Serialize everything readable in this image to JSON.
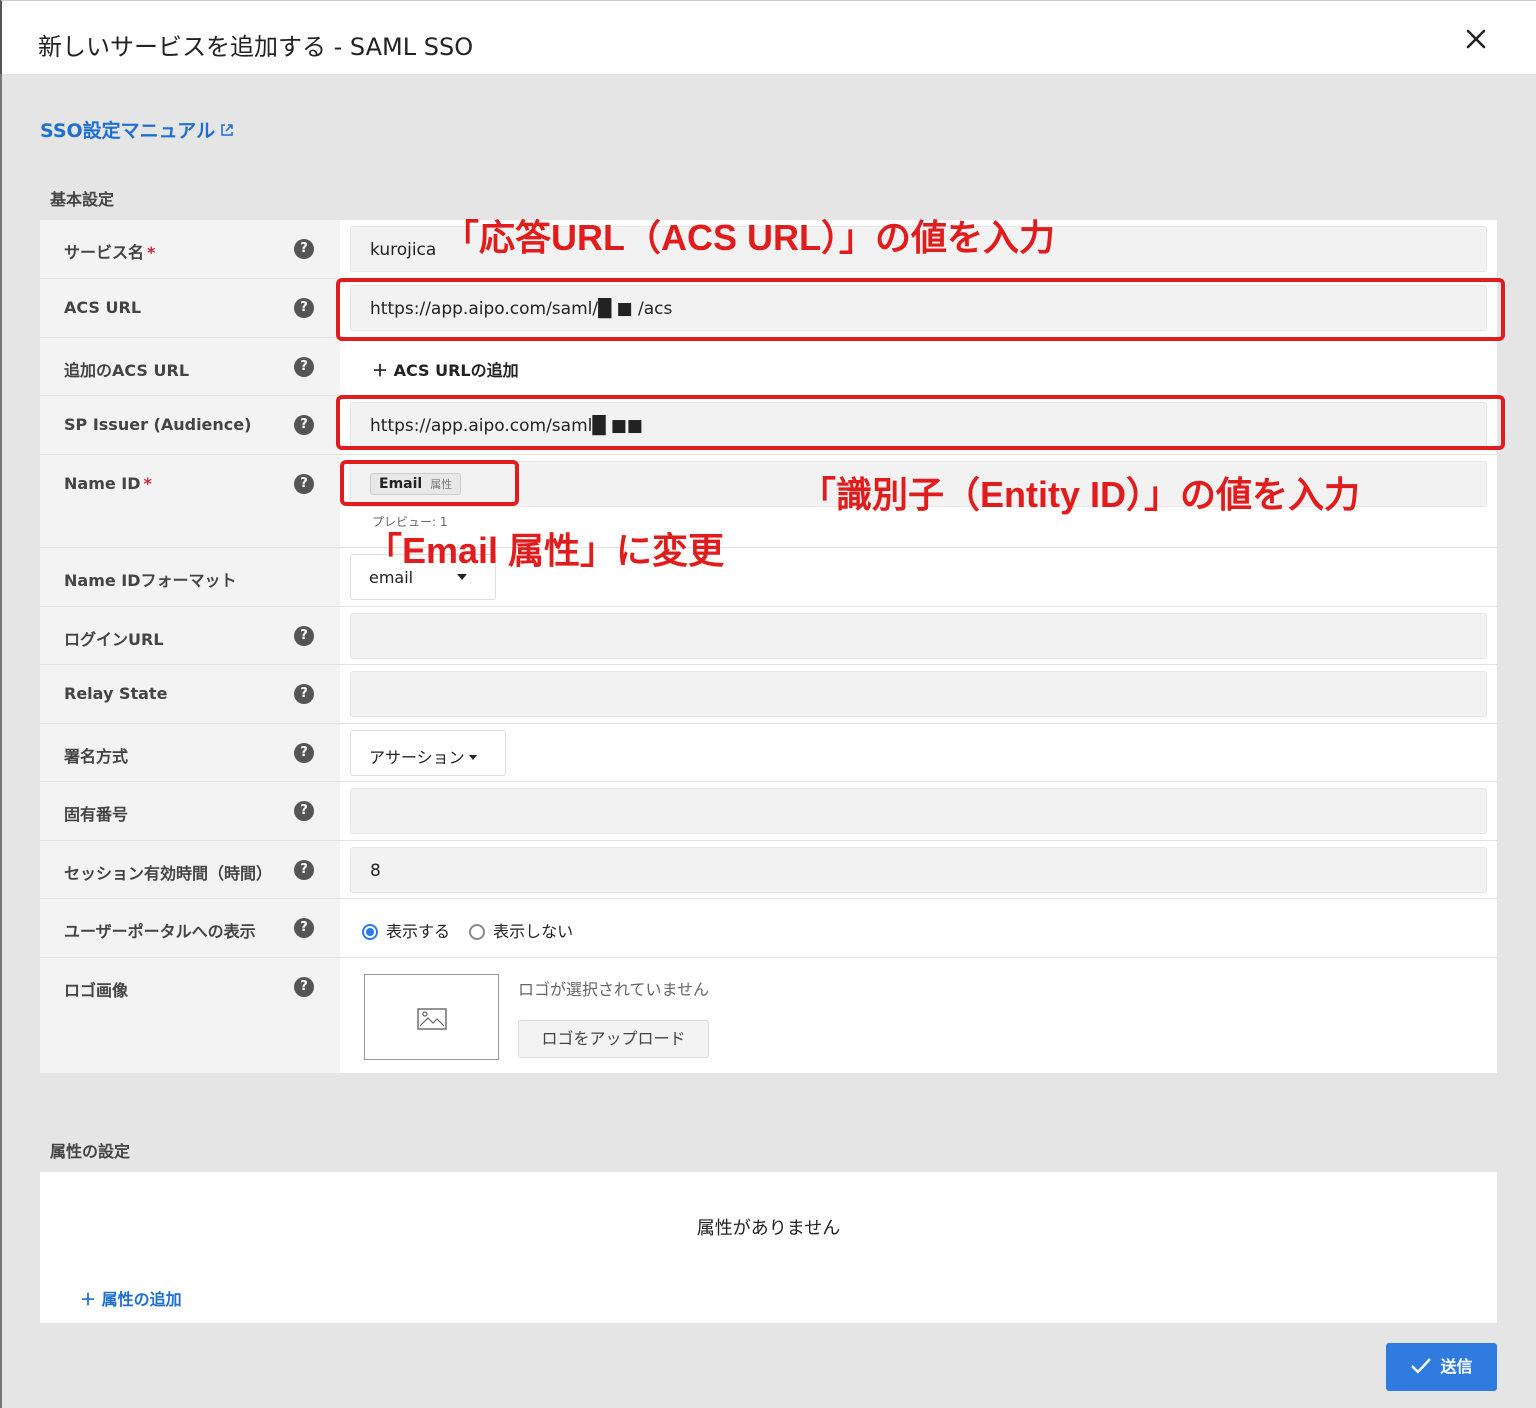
{
  "header": {
    "title": "新しいサービスを追加する - SAML SSO"
  },
  "manual_link": "SSO設定マニュアル",
  "sections": {
    "basic": "基本設定",
    "attributes": "属性の設定"
  },
  "fields": {
    "service_name": {
      "label": "サービス名",
      "required": "*",
      "value": "kurojica"
    },
    "acs_url": {
      "label": "ACS URL",
      "value": "https://app.aipo.com/saml/█ ■ /acs"
    },
    "extra_acs": {
      "label": "追加のACS URL",
      "action": "＋  ACS URLの追加"
    },
    "sp_issuer": {
      "label": "SP Issuer (Audience)",
      "value": "https://app.aipo.com/saml█ ■■"
    },
    "name_id": {
      "label": "Name ID",
      "required": "*",
      "chip": "Email",
      "chip_sub": "属性",
      "preview": "プレビュー: 1"
    },
    "name_id_format": {
      "label": "Name IDフォーマット",
      "value": "email"
    },
    "login_url": {
      "label": "ログインURL",
      "value": ""
    },
    "relay_state": {
      "label": "Relay State",
      "value": ""
    },
    "signing": {
      "label": "署名方式",
      "value": "アサーション"
    },
    "unique_number": {
      "label": "固有番号",
      "value": ""
    },
    "session_hours": {
      "label": "セッション有効時間（時間）",
      "value": "8"
    },
    "portal_display": {
      "label": "ユーザーポータルへの表示",
      "option_show": "表示する",
      "option_hide": "表示しない"
    },
    "logo": {
      "label": "ロゴ画像",
      "message": "ロゴが選択されていません",
      "button": "ロゴをアップロード"
    }
  },
  "help_glyph": "?",
  "annotations": {
    "acs": "「応答URL（ACS URL）」の値を入力",
    "entity": "「識別子（Entity ID）」の値を入力",
    "email": "「Email 属性」に変更"
  },
  "attributes": {
    "empty": "属性がありません",
    "add": "＋  属性の追加"
  },
  "submit": "送信",
  "colors": {
    "accent": "#2f7be0",
    "annotation": "#e11c1c",
    "required": "#d0283a"
  }
}
